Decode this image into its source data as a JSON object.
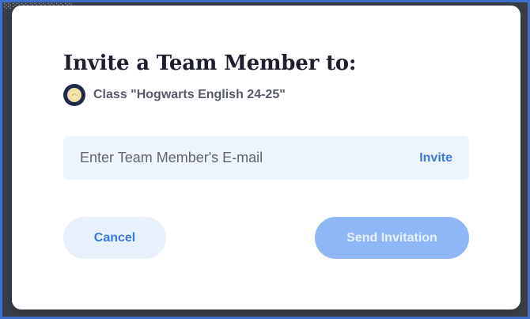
{
  "modal": {
    "title": "Invite a Team Member to:",
    "class_name": "Class \"Hogwarts English 24-25\"",
    "email_placeholder": "Enter Team Member's E-mail",
    "invite_label": "Invite",
    "cancel_label": "Cancel",
    "send_label": "Send Invitation"
  },
  "colors": {
    "accent": "#3a7ae0",
    "send_button_disabled": "#8fb6f5",
    "cancel_button_bg": "#e7f0fb",
    "input_bg": "#eef4fc",
    "title_text": "#1d1f2e",
    "frame": "#3d6fcf"
  },
  "icons": {
    "class_avatar": "class-avatar-icon"
  }
}
